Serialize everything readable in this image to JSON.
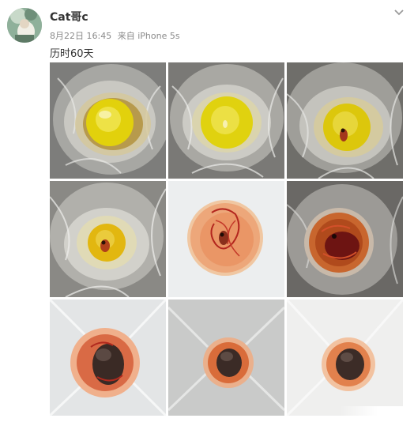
{
  "post": {
    "username": "Cat哥c",
    "date": "8月22日 16:45",
    "source_prefix": "来自",
    "device": "iPhone 5s",
    "text": "历时60天"
  },
  "icons": {
    "menu": "chevron-down-icon"
  },
  "photos": [
    {
      "stage": "yolk-fresh"
    },
    {
      "stage": "yolk-spot"
    },
    {
      "stage": "yolk-embryo-small"
    },
    {
      "stage": "yolk-embryo"
    },
    {
      "stage": "embryo-veins"
    },
    {
      "stage": "embryo-dark"
    },
    {
      "stage": "hatched-1"
    },
    {
      "stage": "hatched-2"
    },
    {
      "stage": "hatched-3"
    }
  ],
  "colors": {
    "username": "#333333",
    "meta": "#8a8a8a",
    "text": "#333333"
  }
}
